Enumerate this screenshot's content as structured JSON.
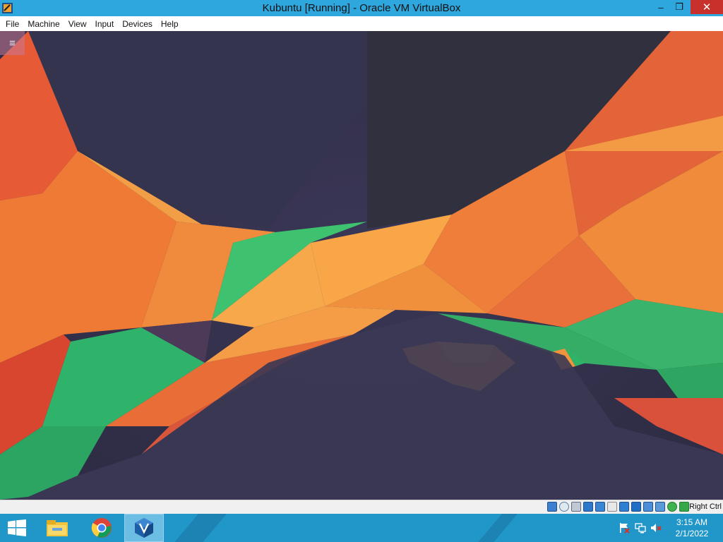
{
  "window": {
    "title": "Kubuntu [Running] - Oracle VM VirtualBox",
    "app_icon": "virtualbox-icon",
    "controls": {
      "minimize": "–",
      "maximize": "❐",
      "close": "✕"
    }
  },
  "menubar": {
    "items": [
      {
        "label": "File"
      },
      {
        "label": "Machine"
      },
      {
        "label": "View"
      },
      {
        "label": "Input"
      },
      {
        "label": "Devices"
      },
      {
        "label": "Help"
      }
    ]
  },
  "vm": {
    "guest_os": "Kubuntu",
    "panel_toggle_glyph": "≡",
    "wallpaper_colors": {
      "dark": "#3c3a5c",
      "orange": "#f29a3a",
      "red": "#e0552f",
      "green": "#33b86a"
    }
  },
  "statusbar": {
    "icons": [
      "hard-disk-icon",
      "optical-drive-icon",
      "audio-icon",
      "network-icon",
      "usb-icon",
      "shared-folders-icon",
      "display-icon",
      "video-capture-icon",
      "recording-icon",
      "cpu-icon",
      "mouse-integration-icon",
      "keyboard-capture-icon"
    ],
    "host_key": "Right Ctrl"
  },
  "taskbar": {
    "apps": [
      "windows-start-icon",
      "file-explorer-icon",
      "chrome-icon",
      "virtualbox-icon"
    ],
    "tray": [
      "action-center-flag-icon",
      "network-tray-icon",
      "volume-muted-icon"
    ],
    "time": "3:15 AM",
    "date": "2/1/2022"
  },
  "colors": {
    "titlebar": "#2ea6de",
    "close_button": "#c7302b",
    "taskbar": "#2196c9"
  }
}
